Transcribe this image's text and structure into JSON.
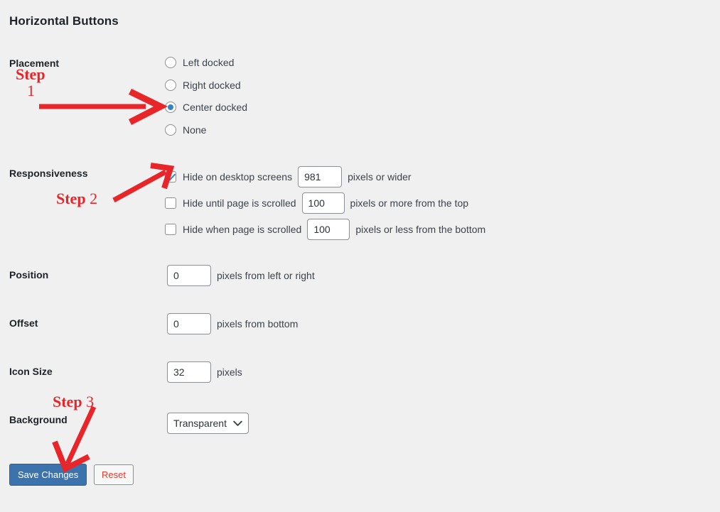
{
  "page": {
    "title": "Horizontal Buttons"
  },
  "placement": {
    "label": "Placement",
    "options": [
      {
        "label": "Left docked",
        "selected": false
      },
      {
        "label": "Right docked",
        "selected": false
      },
      {
        "label": "Center docked",
        "selected": true
      },
      {
        "label": "None",
        "selected": false
      }
    ]
  },
  "responsiveness": {
    "label": "Responsiveness",
    "rows": [
      {
        "text_before": "Hide on desktop screens",
        "value": "981",
        "text_after": "pixels or wider",
        "checked": true
      },
      {
        "text_before": "Hide until page is scrolled",
        "value": "100",
        "text_after": "pixels or more from the top",
        "checked": false
      },
      {
        "text_before": "Hide when page is scrolled",
        "value": "100",
        "text_after": "pixels or less from the bottom",
        "checked": false
      }
    ]
  },
  "position": {
    "label": "Position",
    "value": "0",
    "suffix": "pixels from left or right"
  },
  "offset": {
    "label": "Offset",
    "value": "0",
    "suffix": "pixels from bottom"
  },
  "icon_size": {
    "label": "Icon Size",
    "value": "32",
    "suffix": "pixels"
  },
  "background": {
    "label": "Background",
    "selected": "Transparent",
    "chevron_icon": "chevron-down-icon"
  },
  "actions": {
    "save_label": "Save Changes",
    "reset_label": "Reset"
  },
  "annotations": {
    "step1_word": "Step",
    "step1_num": "1",
    "step2_word": "Step ",
    "step2_num": "2",
    "step3_word": "Step ",
    "step3_num": "3",
    "arrow_icon": "red-arrow-icon",
    "color": "#e8262a"
  },
  "colors": {
    "background": "#f0f0f1",
    "text": "#1d2327",
    "accent_blue": "#3582c4",
    "save_button": "#3c73ad",
    "reset_text": "#e8392e",
    "annotation_red": "#e8262a"
  }
}
